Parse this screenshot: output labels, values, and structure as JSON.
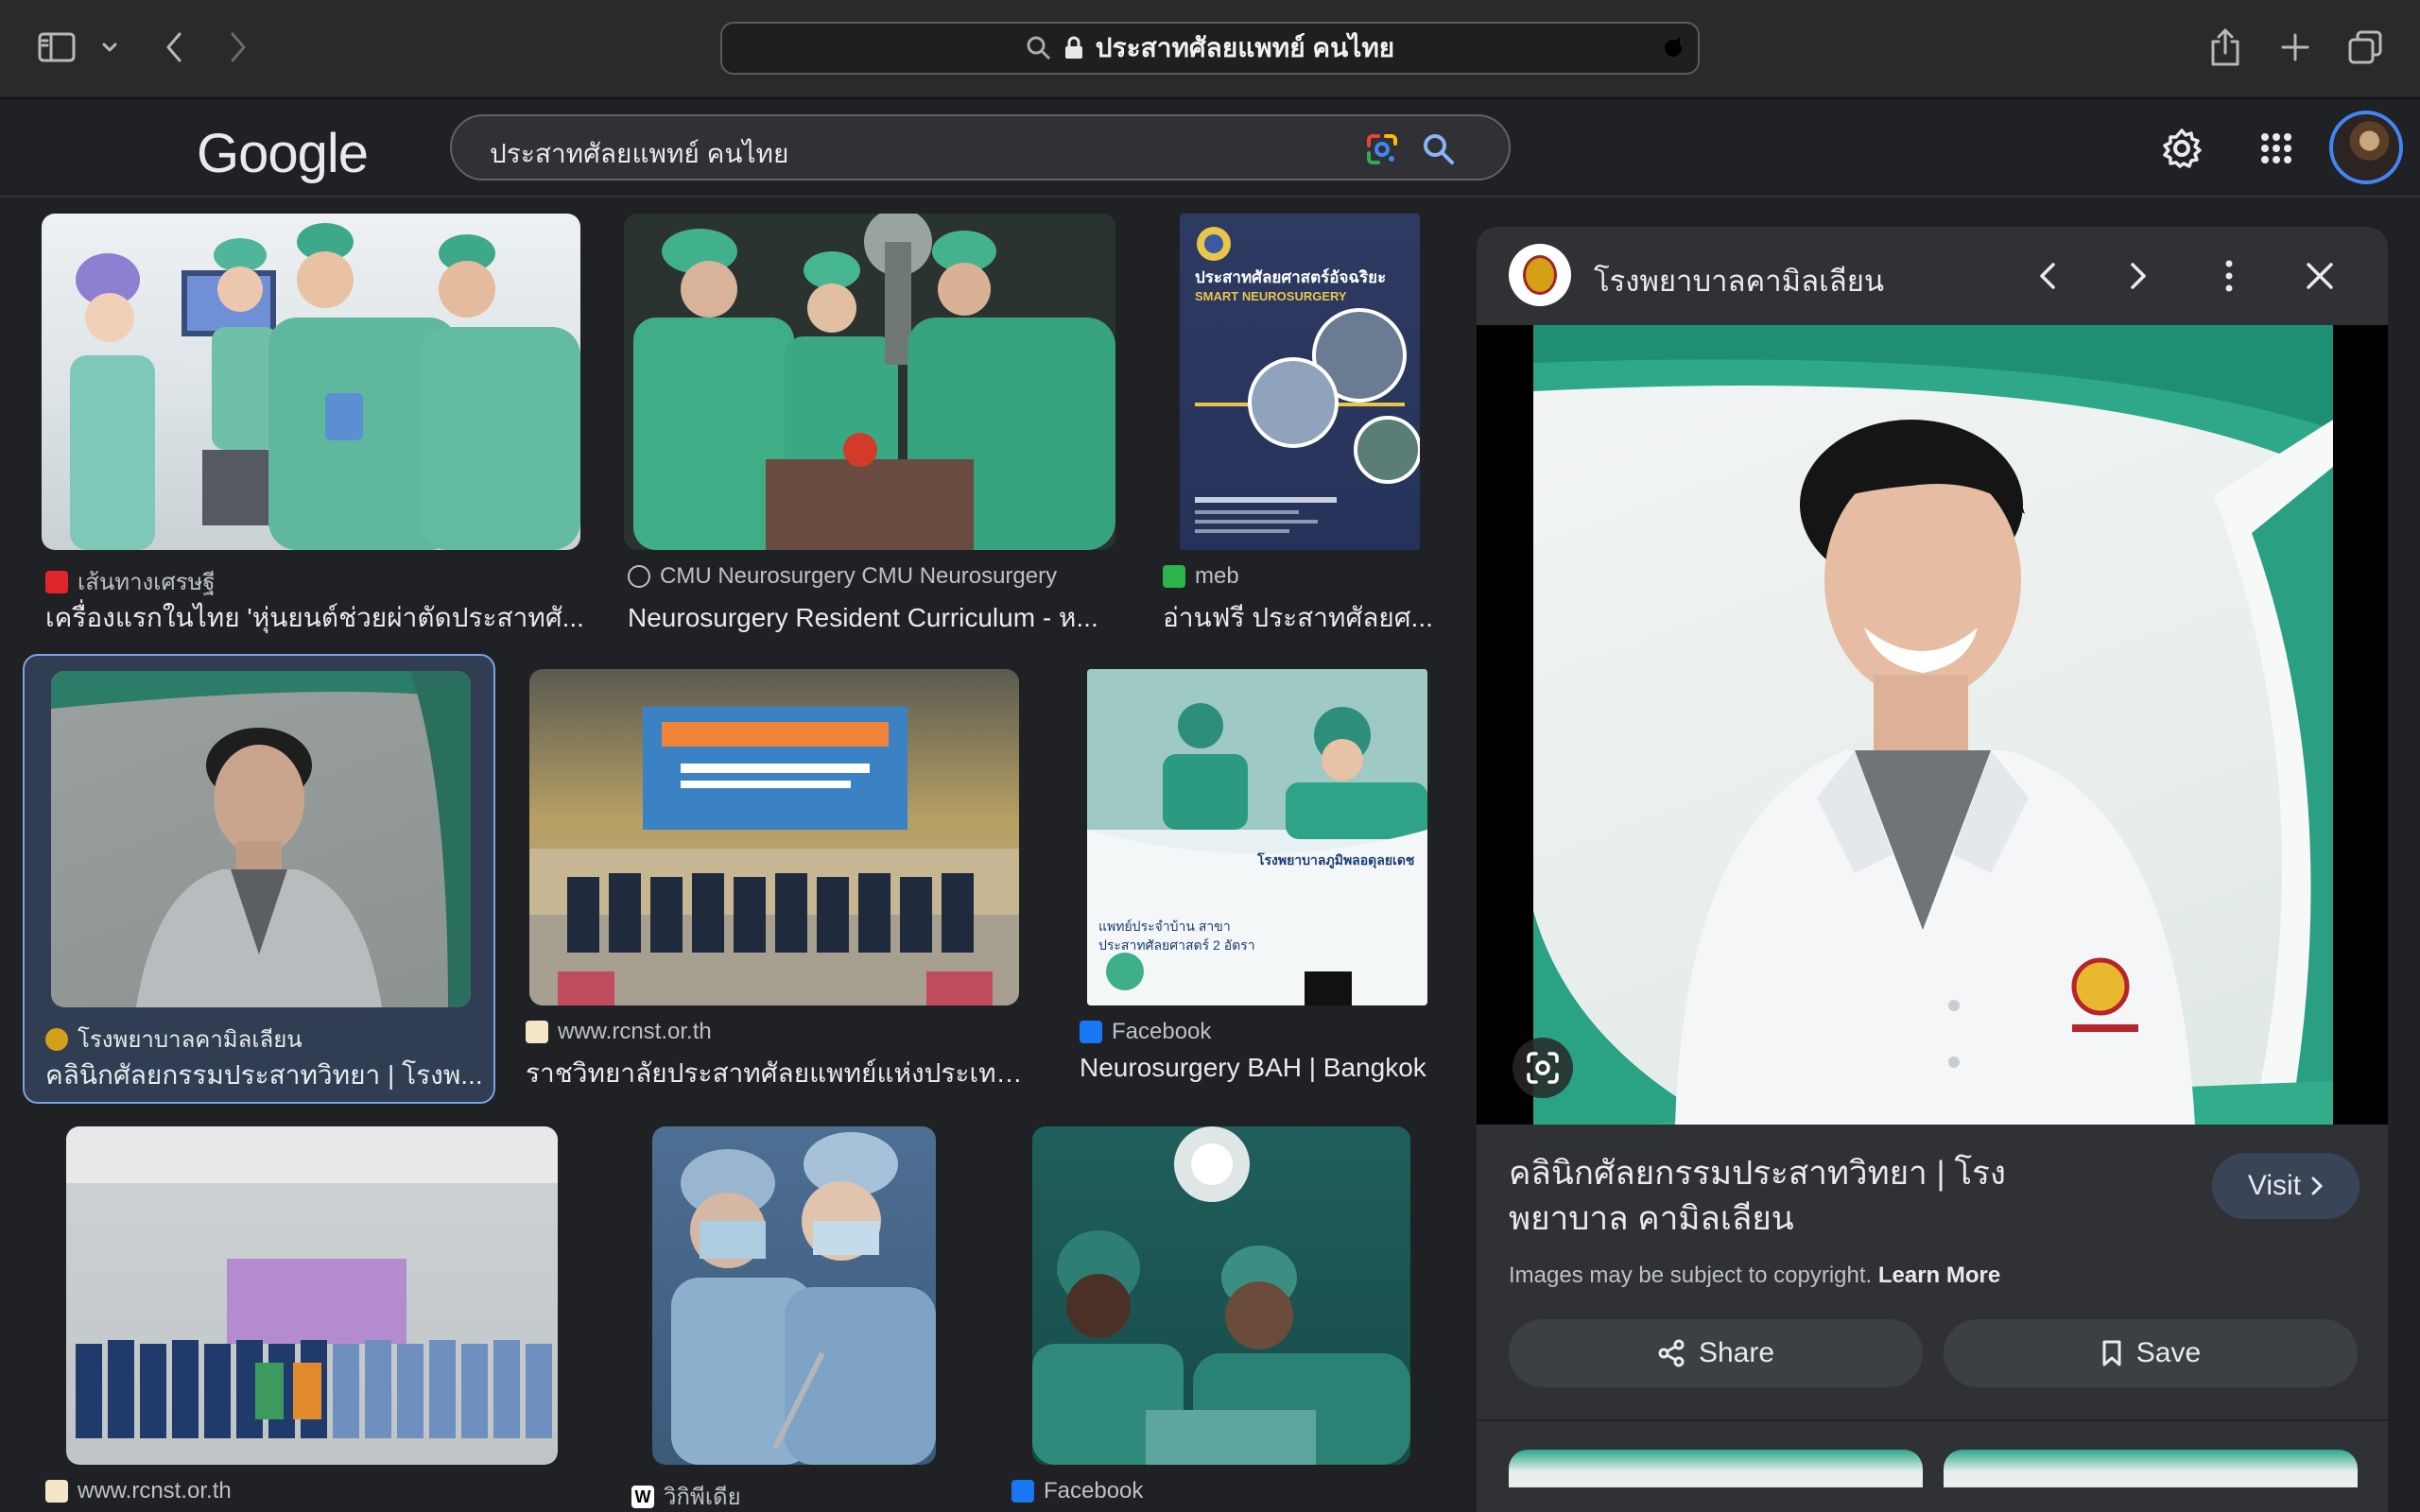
{
  "browser": {
    "url_text": "ประสาทศัลยแพทย์ คนไทย"
  },
  "google": {
    "logo": "Google",
    "query": "ประสาทศัลยแพทย์ คนไทย"
  },
  "results": [
    {
      "source": "เส้นทางเศรษฐี",
      "title": "เครื่องแรกในไทย 'หุ่นยนต์ช่วยผ่าตัดประสาทศั...",
      "favicon": "red-st-icon"
    },
    {
      "source": "CMU Neurosurgery CMU Neurosurgery",
      "title": "Neurosurgery Resident Curriculum - ห...",
      "favicon": "globe-icon"
    },
    {
      "source": "meb",
      "title": "อ่านฟรี ประสาทศัลยศ...",
      "favicon": "meb-icon"
    },
    {
      "source": "โรงพยาบาลคามิลเลียน",
      "title": "คลินิกศัลยกรรมประสาทวิทยา | โรงพ...",
      "favicon": "hospital-icon",
      "selected": true
    },
    {
      "source": "www.rcnst.or.th",
      "title": "ราชวิทยาลัยประสาทศัลยแพทย์แห่งประเทศ...",
      "favicon": "rcnst-icon"
    },
    {
      "source": "Facebook",
      "title": "Neurosurgery BAH | Bangkok",
      "favicon": "facebook-icon"
    },
    {
      "source": "www.rcnst.or.th",
      "title": "",
      "favicon": "rcnst-icon"
    },
    {
      "source": "วิกิพีเดีย",
      "title": "",
      "favicon": "wikipedia-icon"
    },
    {
      "source": "Facebook",
      "title": "",
      "favicon": "facebook-icon"
    }
  ],
  "book_cover": {
    "title": "ประสาทศัลยศาสตร์อัจฉริยะ",
    "subtitle": "SMART NEUROSURGERY"
  },
  "poster": {
    "line1": "โรงพยาบาลภูมิพลอดุลยเดช",
    "line2": "แพทย์ประจำบ้าน สาขา",
    "line3": "ประสาทศัลยศาสตร์ 2 อัตรา"
  },
  "panel": {
    "site_name": "โรงพยาบาลคามิลเลียน",
    "title": "คลินิกศัลยกรรมประสาทวิทยา | โรงพยาบาล คามิลเลียน",
    "visit_label": "Visit",
    "copyright": "Images may be subject to copyright.",
    "learn_more": "Learn More",
    "share_label": "Share",
    "save_label": "Save"
  },
  "colors": {
    "accent_blue": "#7aa3e0",
    "surgical_green": "#2e9e7a",
    "dark_bg": "#202124"
  }
}
